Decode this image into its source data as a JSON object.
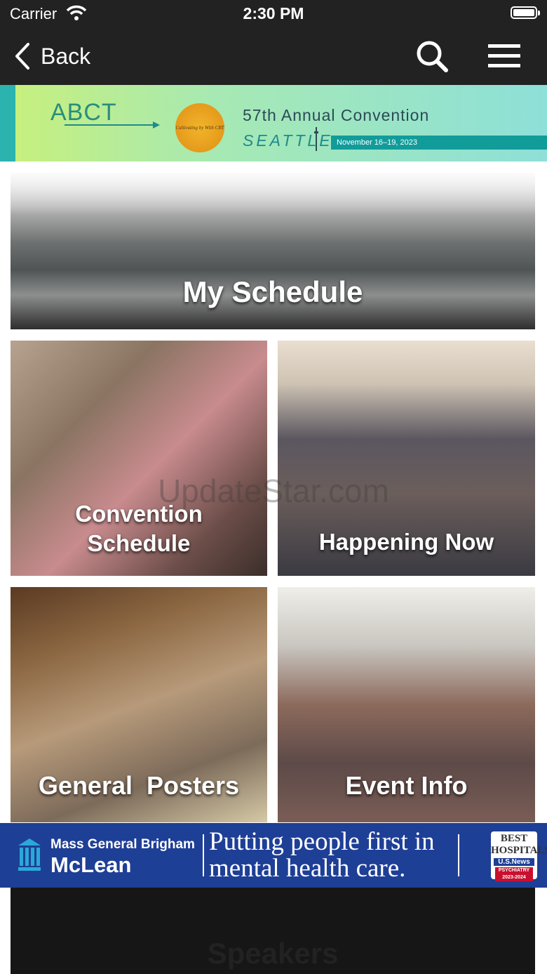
{
  "status_bar": {
    "carrier": "Carrier",
    "time": "2:30 PM"
  },
  "nav": {
    "back_label": "Back"
  },
  "banner": {
    "logo_text": "ABCT",
    "sun_text": "Cultivating by With CBT",
    "title": "57th Annual Convention",
    "city": "SEATTLE",
    "dates": "November 16–19, 2023"
  },
  "tiles": {
    "my_schedule": "My Schedule",
    "convention_schedule_line1": "Convention",
    "convention_schedule_line2": "Schedule",
    "happening_now": "Happening Now",
    "general_posters": "General  Posters",
    "event_info": "Event Info",
    "speakers": "Speakers"
  },
  "watermark": "UpdateStar.com",
  "ad": {
    "brand_line1": "Mass General Brigham",
    "brand_line2": "McLean",
    "tagline_line1": "Putting people first in",
    "tagline_line2": "mental health care.",
    "badge_line1": "BEST HOSPITALS",
    "badge_line2": "U.S.News",
    "badge_line3": "PSYCHIATRY 2023-2024"
  },
  "colors": {
    "nav_bg": "#222222",
    "ad_bg": "#1e3f96",
    "banner_teal": "#119c9a"
  }
}
